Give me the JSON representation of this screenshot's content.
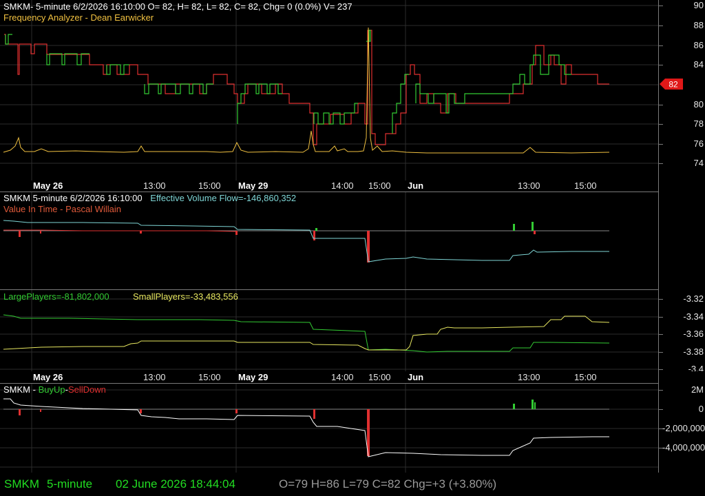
{
  "pane1": {
    "header": "SMKM- 5-minute 6/2/2026 16:10:00 O= 82, H= 82, L= 82, C= 82, Chg= 0 (0.0%) V= 237",
    "indicator": "Frequency Analyzer - Dean Earwicker",
    "yaxis_labels": [
      "90",
      "88",
      "86",
      "84",
      "82",
      "80",
      "78",
      "76",
      "74"
    ],
    "price_tag": "82",
    "colors": {
      "up": "#33cc33",
      "down": "#e03030",
      "analyzer": "#f0c040",
      "tag": "#e01818"
    }
  },
  "xaxis": {
    "labels": [
      {
        "text": "May 26",
        "day": true
      },
      {
        "text": "13:00",
        "day": false
      },
      {
        "text": "15:00",
        "day": false
      },
      {
        "text": "May 29",
        "day": true
      },
      {
        "text": "14:00",
        "day": false
      },
      {
        "text": "15:00",
        "day": false
      },
      {
        "text": "Jun",
        "day": true
      },
      {
        "text": "13:00",
        "day": false
      },
      {
        "text": "15:00",
        "day": false
      }
    ]
  },
  "pane2": {
    "header_prefix": "SMKM 5-minute  6/2/2026 16:10:00",
    "effective_volume": "Effective Volume Flow=-146,860,352",
    "indicator": "Value In Time - Pascal Willain",
    "colors": {
      "flow": "#7fd6d6",
      "prefix": "#ffffff",
      "indicator": "#e05a3a"
    }
  },
  "pane3": {
    "large_players": "LargePlayers=-81,802,000",
    "small_players": "SmallPlayers=-33,483,556",
    "yaxis_labels": [
      "-3.32",
      "-3.34",
      "-3.36",
      "-3.38",
      "-3.4"
    ],
    "colors": {
      "large": "#33cc33",
      "small": "#e8e860"
    }
  },
  "pane4": {
    "title_prefix": "SMKM - ",
    "buy_up": "BuyUp",
    "dash": "-",
    "sell_down": "SellDown",
    "yaxis_labels": [
      "2M",
      "0",
      "-2,000,000",
      "-4,000,000"
    ],
    "colors": {
      "buy": "#33cc33",
      "sell": "#e03030",
      "line": "#ffffff"
    }
  },
  "footer": {
    "symbol": "SMKM",
    "interval": "5-minute",
    "datetime": "02 June 2026 18:44:04",
    "ohlc": "O=79  H=86  L=79  C=82  Chg=+3 (+3.80%)",
    "colors": {
      "left": "#22dd22",
      "right": "#9a9a9a"
    }
  }
}
